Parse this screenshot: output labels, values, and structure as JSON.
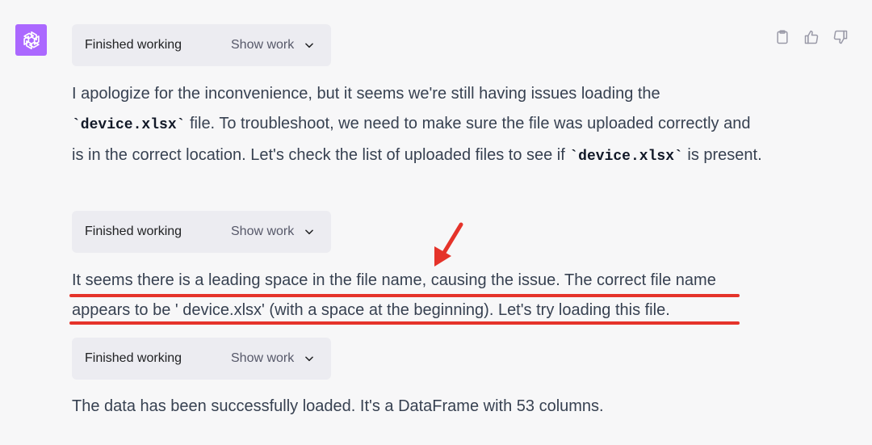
{
  "avatar": {
    "icon": "openai-logo-icon",
    "color": "#ab68ff"
  },
  "actions": [
    {
      "icon": "clipboard-icon",
      "label": "Copy"
    },
    {
      "icon": "thumbs-up-icon",
      "label": "Good response"
    },
    {
      "icon": "thumbs-down-icon",
      "label": "Bad response"
    }
  ],
  "chips": [
    {
      "status": "Finished working",
      "toggle": "Show work",
      "icon": "chevron-down-icon"
    },
    {
      "status": "Finished working",
      "toggle": "Show work",
      "icon": "chevron-down-icon"
    },
    {
      "status": "Finished working",
      "toggle": "Show work",
      "icon": "chevron-down-icon"
    }
  ],
  "paragraphs": {
    "p1": {
      "t1": "I apologize for the inconvenience, but it seems we're still having issues loading the ",
      "c1": "`device.xlsx`",
      "t2": " file. To troubleshoot, we need to make sure the file was uploaded correctly and is in the correct location. Let's check the list of uploaded files to see if ",
      "c2": "`device.xlsx`",
      "t3": " is present."
    },
    "p2": {
      "line1": "It seems there is a leading space in the file name, causing the issue. The correct file name",
      "line2": "appears to be ' device.xlsx' (with a space at the beginning). Let's try loading this file."
    },
    "p3": {
      "text": "The data has been successfully loaded. It's a DataFrame with 53 columns."
    }
  },
  "annotation": {
    "color": "#e5332a",
    "type": "red arrow and underlines"
  }
}
